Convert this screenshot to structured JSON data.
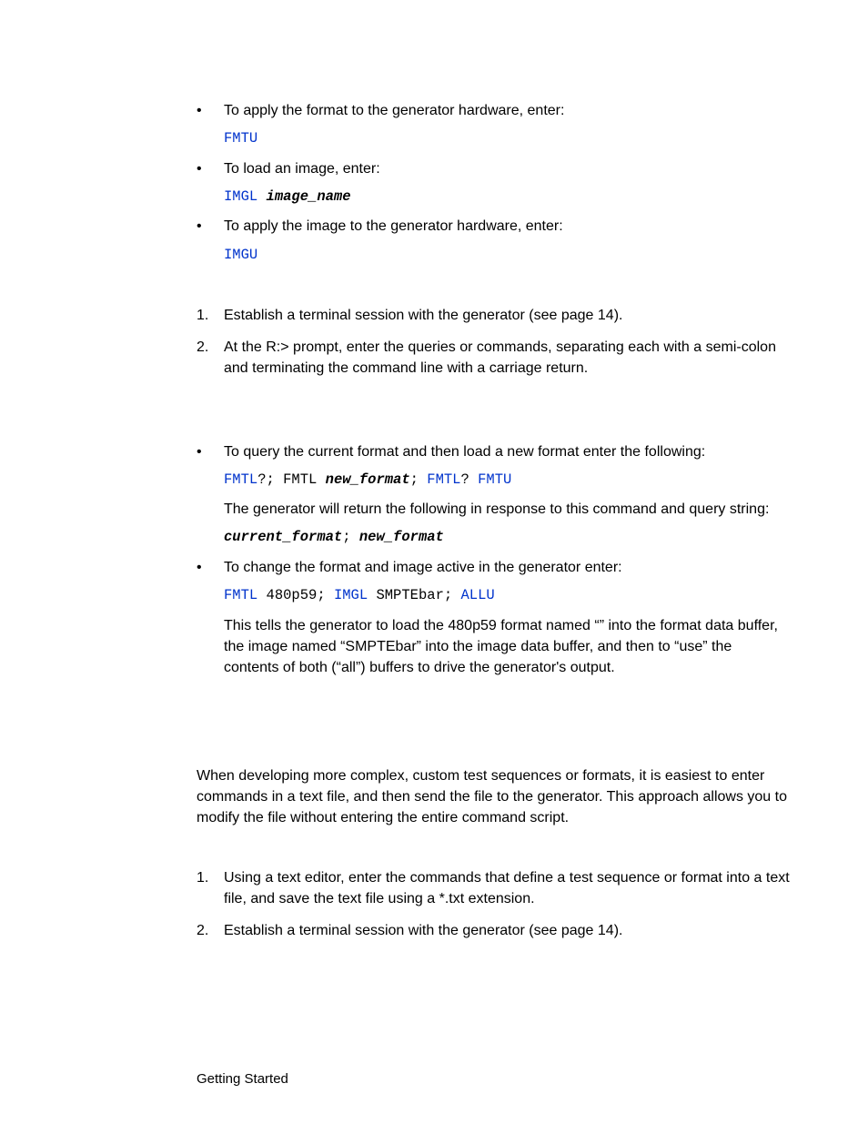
{
  "bullets_a": [
    {
      "text": "To apply the format to the generator hardware, enter:",
      "code": [
        {
          "t": "FMTU",
          "c": "kw"
        }
      ]
    },
    {
      "text": "To load an image, enter:",
      "code": [
        {
          "t": "IMGL ",
          "c": "kw"
        },
        {
          "t": "image_name",
          "c": "it"
        }
      ]
    },
    {
      "text": "To apply the image to the generator hardware, enter:",
      "code": [
        {
          "t": "IMGU",
          "c": "kw"
        }
      ]
    }
  ],
  "steps_a": [
    "Establish a terminal session with the generator (see page 14).",
    "At the R:> prompt, enter the queries or commands, separating each with a semi-colon and terminating the command line with a carriage return."
  ],
  "bullets_b": [
    {
      "text": "To query the current format and then load a new format enter the following:",
      "code": [
        {
          "t": "FMTL",
          "c": "kw"
        },
        {
          "t": "?; FMTL ",
          "c": ""
        },
        {
          "t": "new_format",
          "c": "it"
        },
        {
          "t": "; ",
          "c": ""
        },
        {
          "t": "FMTL",
          "c": "kw"
        },
        {
          "t": "? ",
          "c": ""
        },
        {
          "t": "FMTU",
          "c": "kw"
        }
      ],
      "after": "The generator will return the following in response to this command and query string:",
      "code2": [
        {
          "t": "current_format",
          "c": "it"
        },
        {
          "t": "; ",
          "c": ""
        },
        {
          "t": "new_format",
          "c": "it"
        }
      ]
    },
    {
      "text": "To change the format and image active in the generator enter:",
      "code": [
        {
          "t": "FMTL",
          "c": "kw"
        },
        {
          "t": " 480p59; ",
          "c": ""
        },
        {
          "t": "IMGL",
          "c": "kw"
        },
        {
          "t": " SMPTEbar; ",
          "c": ""
        },
        {
          "t": "ALLU",
          "c": "kw"
        }
      ],
      "after": "This tells the generator to load the 480p59 format named “” into the format data buffer, the image named “SMPTEbar” into the image data buffer, and then to “use” the contents of both (“all”) buffers to drive the generator's output."
    }
  ],
  "paragraph": "When developing more complex, custom test sequences or formats, it is easiest to enter commands in a text file, and then send the file to the generator. This approach allows you to modify the file without entering the entire command script.",
  "steps_b": [
    "Using a text editor, enter the commands that define a test sequence or format into a text file, and save the text file using a *.txt extension.",
    "Establish a terminal session with the generator (see page 14)."
  ],
  "footer": "Getting Started"
}
